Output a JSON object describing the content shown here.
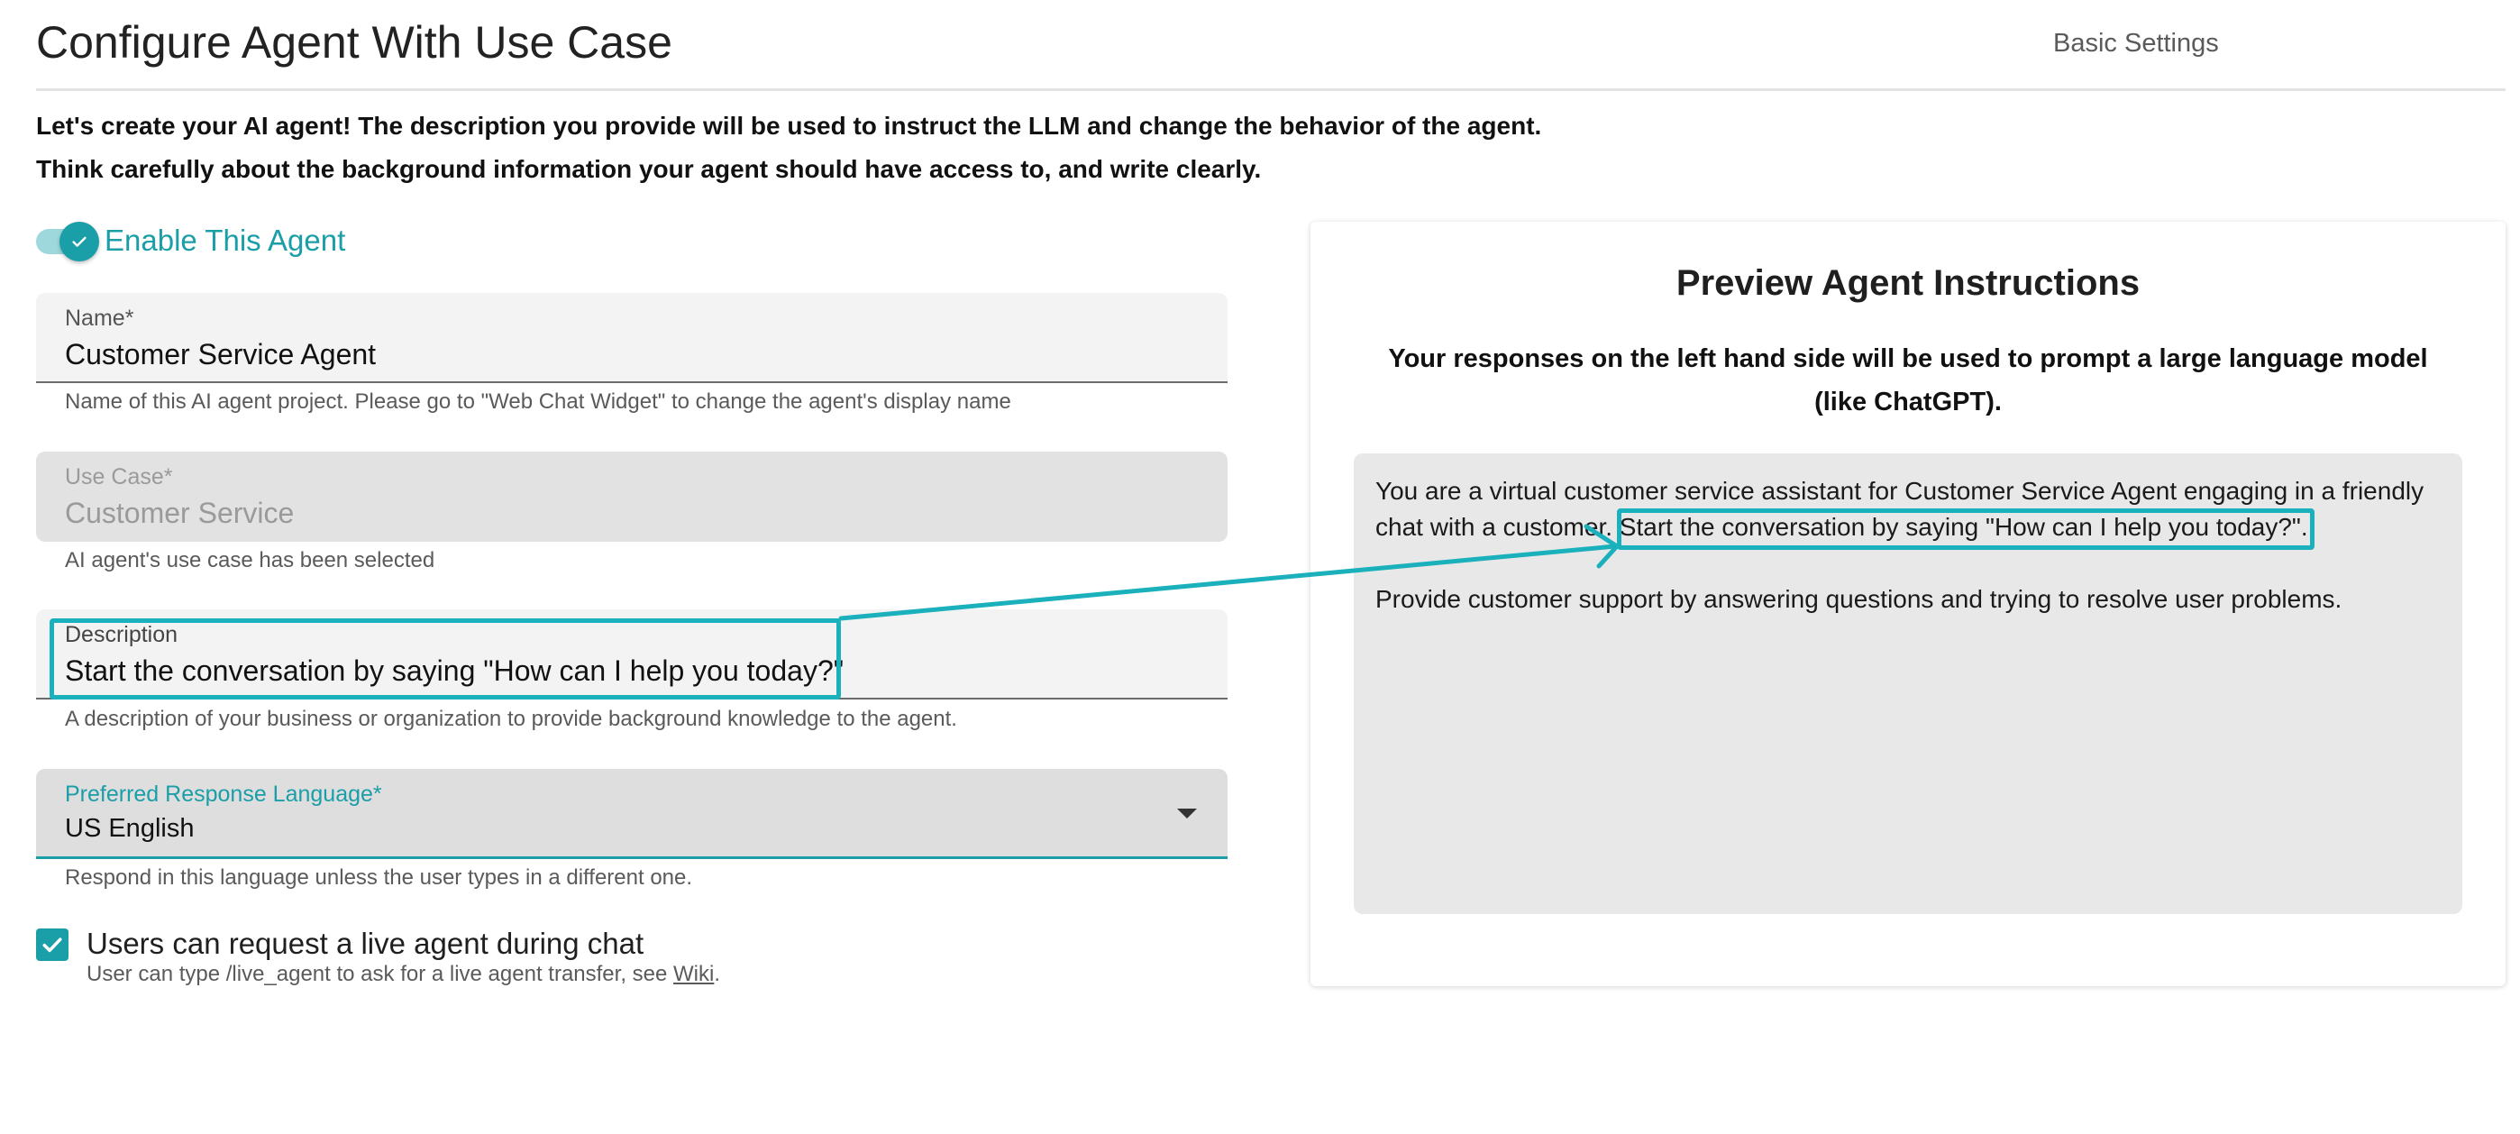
{
  "header": {
    "title": "Configure Agent With Use Case",
    "tab_basic_settings": "Basic Settings"
  },
  "intro": {
    "line1": "Let's create your AI agent! The description you provide will be used to instruct the LLM and  change the behavior of the agent.",
    "line2": "Think carefully about the background information your agent should have access to, and write clearly."
  },
  "enable_toggle": {
    "label": "Enable This Agent",
    "checked": true
  },
  "form": {
    "name": {
      "label": "Name",
      "required_mark": "*",
      "value": "Customer Service Agent",
      "helper": "Name of this AI agent project. Please go to \"Web Chat Widget\" to change the agent's display name"
    },
    "use_case": {
      "label": "Use Case",
      "required_mark": "*",
      "value": "Customer Service",
      "helper": "AI agent's use case has been selected"
    },
    "description": {
      "label": "Description",
      "value": "Start the conversation by saying \"How can I help you today?\"",
      "helper": "A description of your business or organization to provide background knowledge to the agent."
    },
    "language": {
      "label": "Preferred Response Language",
      "required_mark": "*",
      "value": "US English",
      "helper": "Respond in this language unless the user types in a different one."
    },
    "live_agent": {
      "label": "Users can request a live agent during chat",
      "helper_prefix": "User can type /live_agent to ask for a live agent transfer, see ",
      "helper_link": "Wiki",
      "helper_suffix": ".",
      "checked": true
    }
  },
  "preview": {
    "title": "Preview Agent Instructions",
    "subtitle": "Your responses on the left hand side will be used to prompt a large language model (like ChatGPT).",
    "paragraph1": "You are a virtual customer service assistant for Customer Service Agent  engaging in a friendly chat with a customer. Start the conversation by saying \"How can I help you today?\".",
    "paragraph2": "Provide customer support by answering questions and trying to resolve user problems."
  },
  "colors": {
    "accent": "#1a9ea8",
    "annotation": "#1ab0bc"
  }
}
